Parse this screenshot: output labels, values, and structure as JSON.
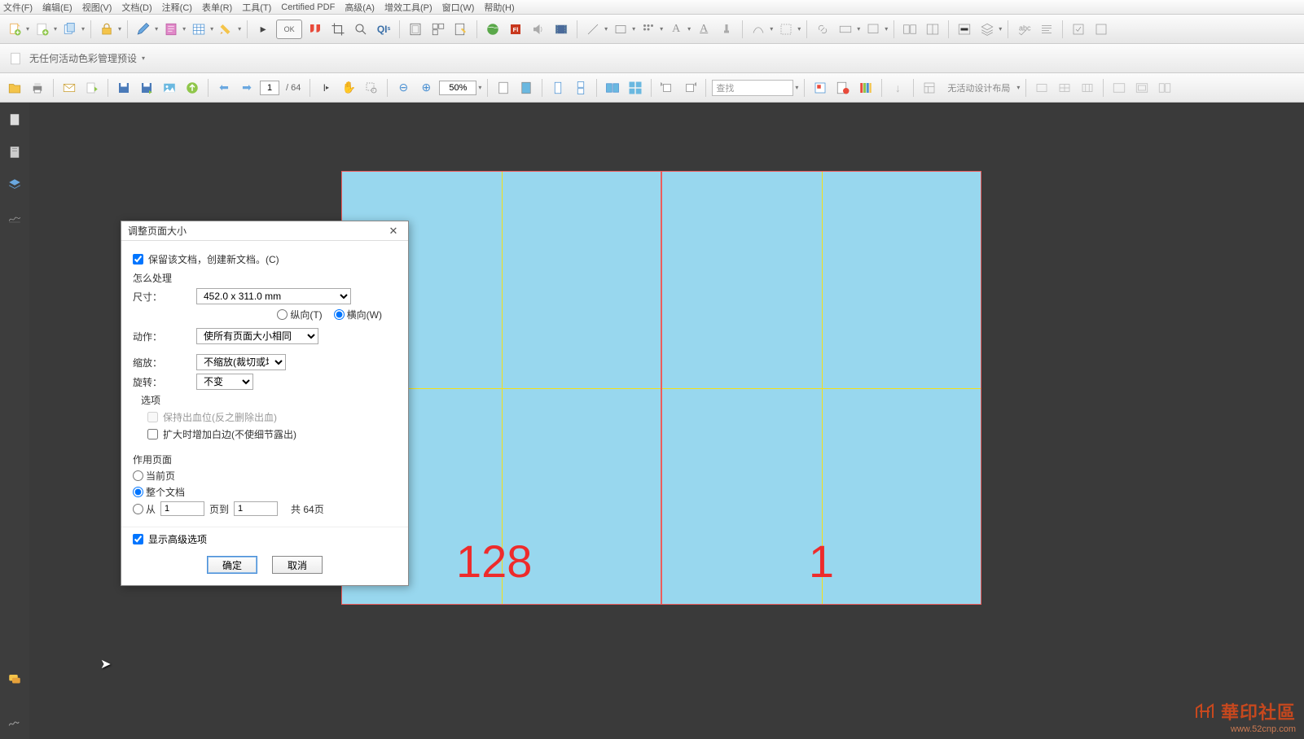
{
  "menu": {
    "file": "文件(F)",
    "edit": "编辑(E)",
    "view": "视图(V)",
    "document": "文档(D)",
    "annotate": "注释(C)",
    "forms": "表单(R)",
    "tools": "工具(T)",
    "certified": "Certified PDF",
    "advanced": "高级(A)",
    "plugins": "增效工具(P)",
    "window": "窗口(W)",
    "help": "帮助(H)"
  },
  "preset_bar": {
    "label": "无任何活动色彩管理预设"
  },
  "toolbar3": {
    "page_current": "1",
    "page_total": "/ 64",
    "zoom": "50%",
    "find_placeholder": "查找",
    "layout_label": "无活动设计布局"
  },
  "canvas": {
    "left_page_number": "128",
    "right_page_number": "1"
  },
  "dialog": {
    "title": "调整页面大小",
    "preserve_doc": "保留该文档，创建新文档。(C)",
    "how_section": "怎么处理",
    "size_label": "尺寸：",
    "size_value": "452.0 x 311.0 mm",
    "portrait": "纵向(T)",
    "landscape": "横向(W)",
    "action_label": "动作：",
    "action_value": "使所有页面大小相同",
    "scale_label": "缩放：",
    "scale_value": "不缩放(裁切或填补)",
    "rotate_label": "旋转：",
    "rotate_value": "不变",
    "options_label": "选项",
    "keep_bleed": "保持出血位(反之删除出血)",
    "add_white": "扩大时增加白边(不使细节露出)",
    "range_section": "作用页面",
    "current_page": "当前页",
    "whole_doc": "整个文档",
    "from_label": "从",
    "from_val": "1",
    "to_label": "页到",
    "to_val": "1",
    "total_label": "共 64页",
    "show_adv": "显示高级选项",
    "ok": "确定",
    "cancel": "取消"
  },
  "watermark": {
    "brand": "華印社區",
    "url": "www.52cnp.com"
  }
}
